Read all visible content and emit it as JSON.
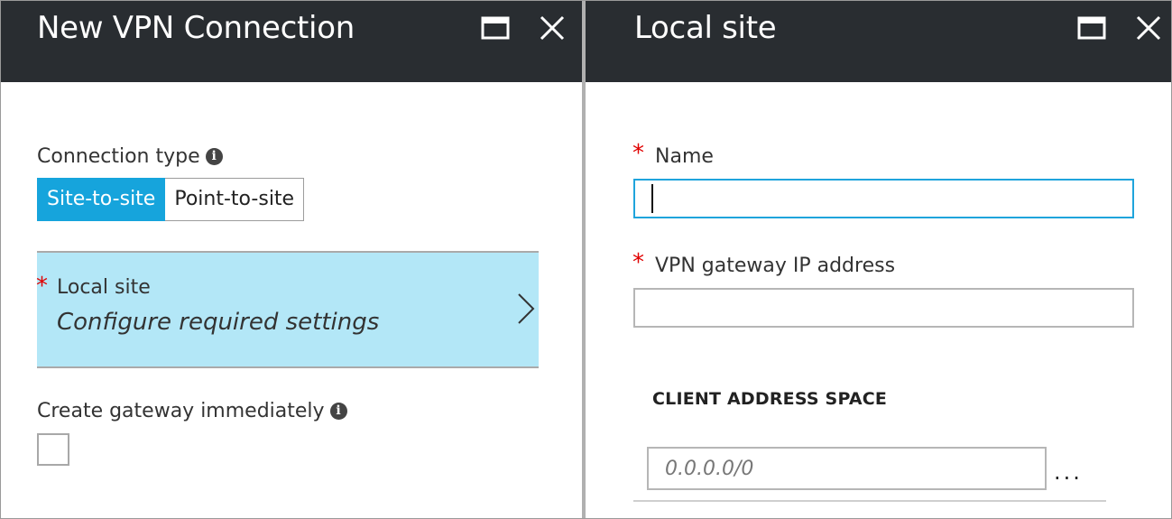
{
  "left_blade": {
    "title": "New VPN Connection",
    "header_buttons": {
      "maximize": "maximize-icon",
      "close": "close-icon"
    },
    "connection_type": {
      "label": "Connection type",
      "info_icon": "i",
      "options": [
        {
          "label": "Site-to-site",
          "selected": true
        },
        {
          "label": "Point-to-site",
          "selected": false
        }
      ]
    },
    "local_site": {
      "required_mark": "*",
      "label": "Local site",
      "value": "Configure required settings",
      "icon": "chevron-right-icon"
    },
    "create_gateway": {
      "label": "Create gateway immediately",
      "info_icon": "i",
      "checked": false
    }
  },
  "right_blade": {
    "title": "Local site",
    "header_buttons": {
      "maximize": "maximize-icon",
      "close": "close-icon"
    },
    "name_field": {
      "required_mark": "*",
      "label": "Name",
      "value": ""
    },
    "gateway_ip_field": {
      "required_mark": "*",
      "label": "VPN gateway IP address",
      "value": ""
    },
    "client_address_space": {
      "heading": "CLIENT ADDRESS SPACE",
      "placeholder": "0.0.0.0/0",
      "more_label": "..."
    }
  },
  "colors": {
    "header_bg": "#292d31",
    "accent": "#16a4dc",
    "selected_row_bg": "#b3e7f7",
    "required": "#e00000"
  }
}
